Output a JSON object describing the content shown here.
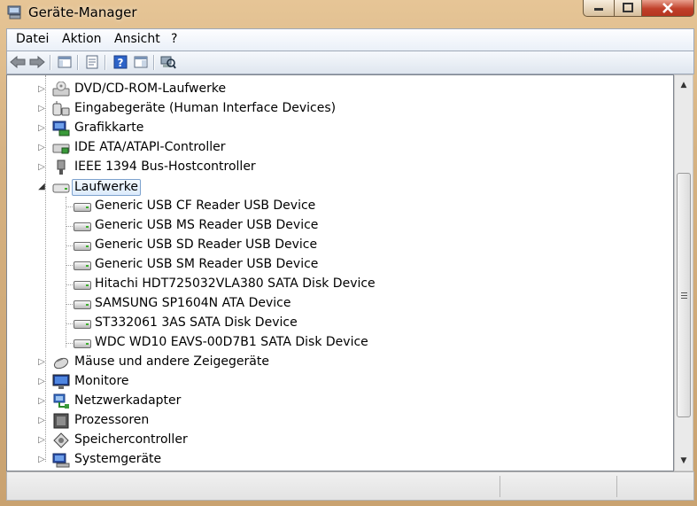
{
  "window": {
    "title": "Geräte-Manager"
  },
  "menu": {
    "items": [
      "Datei",
      "Aktion",
      "Ansicht",
      "?"
    ]
  },
  "tree": {
    "categories_top": [
      {
        "label": "DVD/CD-ROM-Laufwerke",
        "icon": "dvd-drive-icon"
      },
      {
        "label": "Eingabegeräte (Human Interface Devices)",
        "icon": "input-device-icon"
      },
      {
        "label": "Grafikkarte",
        "icon": "display-adapter-icon"
      },
      {
        "label": "IDE ATA/ATAPI-Controller",
        "icon": "ide-controller-icon"
      },
      {
        "label": "IEEE 1394 Bus-Hostcontroller",
        "icon": "firewire-icon"
      }
    ],
    "expanded": {
      "label": "Laufwerke",
      "children": [
        "Generic USB CF Reader USB Device",
        "Generic USB MS Reader USB Device",
        "Generic USB SD Reader USB Device",
        "Generic USB SM Reader USB Device",
        "Hitachi HDT725032VLA380 SATA Disk Device",
        "SAMSUNG SP1604N ATA Device",
        "ST332061 3AS SATA Disk Device",
        "WDC WD10 EAVS-00D7B1 SATA Disk Device"
      ]
    },
    "categories_bottom": [
      {
        "label": "Mäuse und andere Zeigegeräte",
        "icon": "mouse-icon"
      },
      {
        "label": "Monitore",
        "icon": "monitor-icon"
      },
      {
        "label": "Netzwerkadapter",
        "icon": "network-adapter-icon"
      },
      {
        "label": "Prozessoren",
        "icon": "processor-icon"
      },
      {
        "label": "Speichercontroller",
        "icon": "storage-controller-icon"
      },
      {
        "label": "Systemgeräte",
        "icon": "system-devices-icon"
      }
    ]
  }
}
